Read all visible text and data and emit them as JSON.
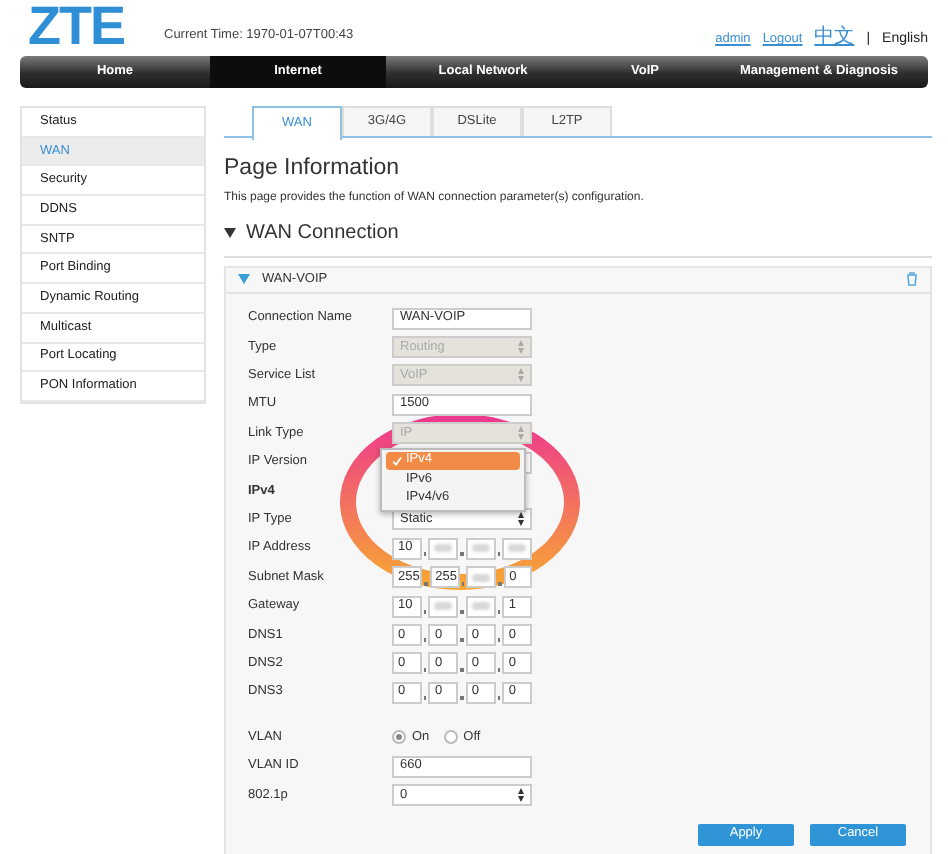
{
  "header": {
    "logo": "ZTE",
    "current_time": "Current Time: 1970-01-07T00:43",
    "links": [
      {
        "label": "admin",
        "kind": "link"
      },
      {
        "label": "Logout",
        "kind": "link"
      },
      {
        "label": "中文",
        "kind": "link"
      },
      {
        "label": "|",
        "kind": "sep"
      },
      {
        "label": "English",
        "kind": "current"
      }
    ]
  },
  "nav": [
    {
      "label": "Home",
      "selected": false
    },
    {
      "label": "Internet",
      "selected": true
    },
    {
      "label": "Local Network",
      "selected": false
    },
    {
      "label": "VoIP",
      "selected": false
    },
    {
      "label": "Management & Diagnosis",
      "selected": false
    }
  ],
  "sidebar": [
    {
      "label": "Status",
      "selected": false
    },
    {
      "label": "WAN",
      "selected": true
    },
    {
      "label": "Security",
      "selected": false
    },
    {
      "label": "DDNS",
      "selected": false
    },
    {
      "label": "SNTP",
      "selected": false
    },
    {
      "label": "Port Binding",
      "selected": false
    },
    {
      "label": "Dynamic Routing",
      "selected": false
    },
    {
      "label": "Multicast",
      "selected": false
    },
    {
      "label": "Port Locating",
      "selected": false
    },
    {
      "label": "PON Information",
      "selected": false
    }
  ],
  "tabs": [
    {
      "label": "WAN",
      "selected": true
    },
    {
      "label": "3G/4G",
      "selected": false
    },
    {
      "label": "DSLite",
      "selected": false
    },
    {
      "label": "L2TP",
      "selected": false
    }
  ],
  "page_title": "Page Information",
  "page_description": "This page provides the function of WAN connection parameter(s) configuration.",
  "section_title": "WAN Connection",
  "panel": {
    "title": "WAN-VOIP",
    "expanded": true,
    "rows": [
      {
        "kind": "text",
        "label": "Connection Name",
        "value": "WAN-VOIP"
      },
      {
        "kind": "select",
        "label": "Type",
        "value": "Routing",
        "disabled": true
      },
      {
        "kind": "select",
        "label": "Service List",
        "value": "VoIP",
        "disabled": true
      },
      {
        "kind": "text",
        "label": "MTU",
        "value": "1500"
      },
      {
        "kind": "select",
        "label": "Link Type",
        "value": "IP",
        "disabled": true
      },
      {
        "kind": "select",
        "label": "IP Version",
        "disabled": false,
        "open": true,
        "options": [
          {
            "label": "IPv4",
            "selected": true
          },
          {
            "label": "IPv6",
            "selected": false
          },
          {
            "label": "IPv4/v6",
            "selected": false
          }
        ]
      },
      {
        "kind": "heading",
        "label": "IPv4"
      },
      {
        "kind": "select",
        "label": "IP Type",
        "value": "Static",
        "disabled": false
      },
      {
        "kind": "ip",
        "label": "IP Address",
        "octets": [
          {
            "value": "10"
          },
          {
            "blurred": true
          },
          {
            "blurred": true
          },
          {
            "blurred": true
          }
        ]
      },
      {
        "kind": "ip",
        "label": "Subnet Mask",
        "octets": [
          {
            "value": "255"
          },
          {
            "value": "255"
          },
          {
            "blurred": true
          },
          {
            "value": "0"
          }
        ]
      },
      {
        "kind": "ip",
        "label": "Gateway",
        "octets": [
          {
            "value": "10"
          },
          {
            "blurred": true
          },
          {
            "blurred": true
          },
          {
            "value": "1"
          }
        ]
      },
      {
        "kind": "ip",
        "label": "DNS1",
        "octets": [
          {
            "value": "0"
          },
          {
            "value": "0"
          },
          {
            "value": "0"
          },
          {
            "value": "0"
          }
        ]
      },
      {
        "kind": "ip",
        "label": "DNS2",
        "octets": [
          {
            "value": "0"
          },
          {
            "value": "0"
          },
          {
            "value": "0"
          },
          {
            "value": "0"
          }
        ]
      },
      {
        "kind": "ip",
        "label": "DNS3",
        "octets": [
          {
            "value": "0"
          },
          {
            "value": "0"
          },
          {
            "value": "0"
          },
          {
            "value": "0"
          }
        ]
      },
      {
        "kind": "radio",
        "label": "VLAN",
        "options": [
          {
            "label": "On",
            "selected": true
          },
          {
            "label": "Off",
            "selected": false
          }
        ]
      },
      {
        "kind": "text",
        "label": "VLAN ID",
        "value": "660"
      },
      {
        "kind": "select",
        "label": "802.1p",
        "value": "0",
        "disabled": false
      }
    ],
    "buttons": [
      "Apply",
      "Cancel"
    ]
  }
}
